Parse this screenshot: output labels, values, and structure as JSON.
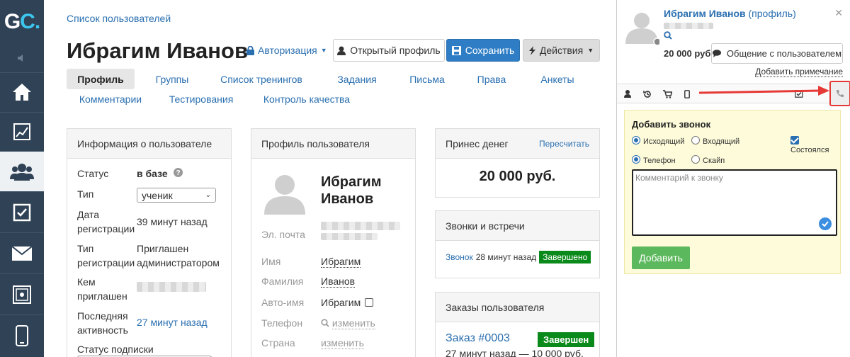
{
  "logo": {
    "g": "G",
    "c": "C",
    "dot": "."
  },
  "breadcrumb": "Список пользователей",
  "title": "Ибрагим Иванов",
  "auth_label": "Авторизация",
  "buttons": {
    "open_profile": "Открытый профиль",
    "save": "Сохранить",
    "actions": "Действия"
  },
  "tabs": [
    "Профиль",
    "Группы",
    "Список тренингов",
    "Задания",
    "Письма",
    "Права",
    "Анкеты",
    "Комментарии",
    "Тестирования",
    "Контроль качества"
  ],
  "user_info": {
    "header": "Информация о пользователе",
    "status_label": "Статус",
    "status_value": "в базе",
    "type_label": "Тип",
    "type_value": "ученик",
    "reg_label_1": "Дата",
    "reg_label_2": "регистрации",
    "reg_value": "39 минут назад",
    "regtype_label_1": "Тип",
    "regtype_label_2": "регистрации",
    "regtype_value_1": "Приглашен",
    "regtype_value_2": "администратором",
    "invited_label_1": "Кем",
    "invited_label_2": "приглашен",
    "activity_label_1": "Последняя",
    "activity_label_2": "активность",
    "activity_value": "27 минут назад",
    "sub_label": "Статус подписки"
  },
  "profile": {
    "header": "Профиль пользователя",
    "name_1": "Ибрагим",
    "name_2": "Иванов",
    "email_label": "Эл. почта",
    "first_label": "Имя",
    "first_value": "Ибрагим",
    "last_label": "Фамилия",
    "last_value": "Иванов",
    "auto_label": "Авто-имя",
    "auto_value": "Ибрагим",
    "phone_label": "Телефон",
    "phone_link": "изменить",
    "country_label": "Страна",
    "country_link": "изменить"
  },
  "money": {
    "header": "Принес денег",
    "recalc": "Пересчитать",
    "amount": "20 000 руб."
  },
  "calls": {
    "header": "Звонки и встречи",
    "link": "Звонок",
    "time": "28 минут назад",
    "badge": "Завершено"
  },
  "orders": {
    "header": "Заказы пользователя",
    "order": "Заказ #0003",
    "badge": "Завершен",
    "meta": "27 минут назад — 10 000 руб."
  },
  "side": {
    "name": "Ибрагим Иванов",
    "profile_link": "(профиль)",
    "amount": "20 000 руб.",
    "chat_btn": "Общение с пользователем",
    "add_note": "Добавить примечание",
    "call": {
      "title": "Добавить звонок",
      "outgoing": "Исходящий",
      "incoming": "Входящий",
      "happened": "Состоялся",
      "phone": "Телефон",
      "skype": "Скайп",
      "comment_placeholder": "Комментарий к звонку",
      "add_btn": "Добавить"
    }
  },
  "colors": {
    "rail": "#2f4256",
    "accent": "#2a6fb0",
    "save": "#2f7ec5",
    "success": "#0a8a1a",
    "add": "#5cb85c",
    "arrow": "#e53935"
  }
}
